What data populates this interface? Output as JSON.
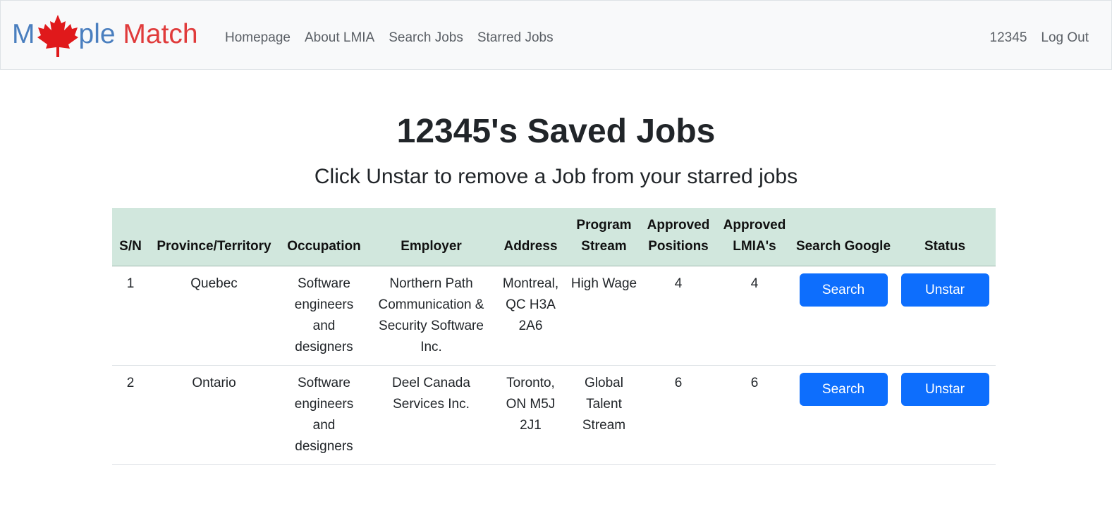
{
  "nav": {
    "brand_part1": "M",
    "brand_part2": "ple",
    "brand_part3": "Match",
    "links": [
      "Homepage",
      "About LMIA",
      "Search Jobs",
      "Starred Jobs"
    ],
    "username": "12345",
    "logout": "Log Out"
  },
  "page": {
    "title": "12345's Saved Jobs",
    "subtitle": "Click Unstar to remove a Job from your starred jobs"
  },
  "table": {
    "headers": {
      "sn": "S/N",
      "province": "Province/Territory",
      "occupation": "Occupation",
      "employer": "Employer",
      "address": "Address",
      "program": "Program Stream",
      "positions": "Approved Positions",
      "lmias": "Approved LMIA's",
      "search": "Search Google",
      "status": "Status"
    },
    "rows": [
      {
        "sn": "1",
        "province": "Quebec",
        "occupation": "Software engineers and designers",
        "employer": "Northern Path Communication & Security Software Inc.",
        "address": "Montreal, QC H3A 2A6",
        "program": "High Wage",
        "positions": "4",
        "lmias": "4",
        "search_label": "Search",
        "status_label": "Unstar"
      },
      {
        "sn": "2",
        "province": "Ontario",
        "occupation": "Software engineers and designers",
        "employer": "Deel Canada Services Inc.",
        "address": "Toronto, ON M5J 2J1",
        "program": "Global Talent Stream",
        "positions": "6",
        "lmias": "6",
        "search_label": "Search",
        "status_label": "Unstar"
      }
    ]
  },
  "colors": {
    "brand_blue": "#4a7fbf",
    "brand_red": "#e03b3b",
    "header_bg": "#d1e7dd",
    "button_bg": "#0d6efd"
  }
}
